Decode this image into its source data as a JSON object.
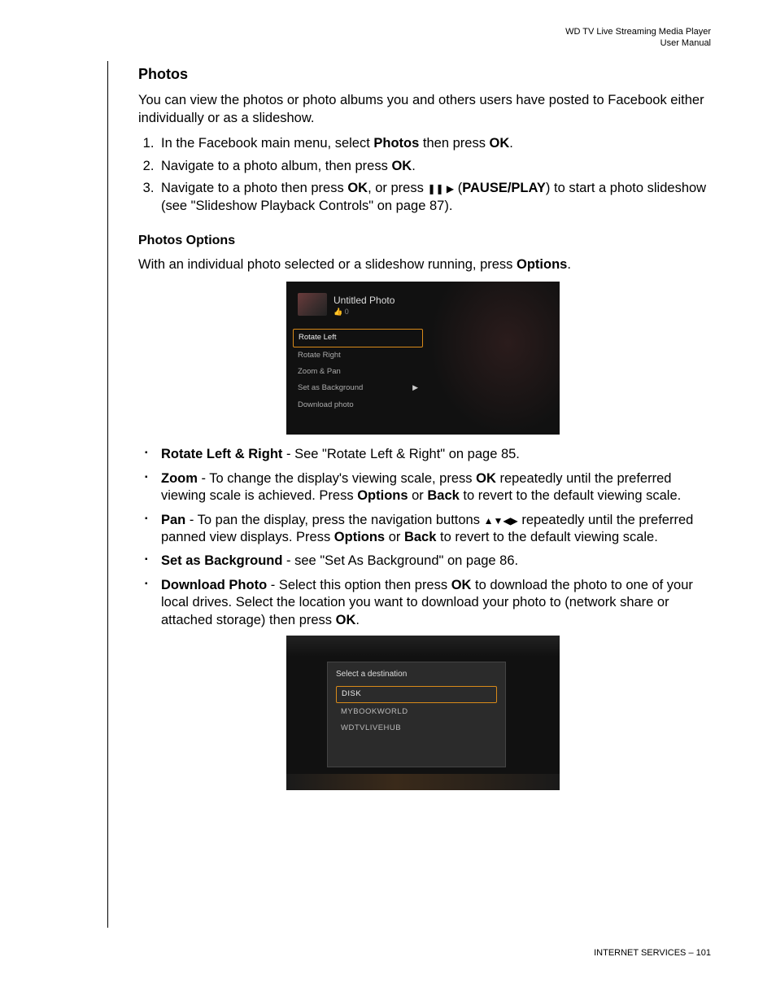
{
  "header": {
    "product": "WD TV Live Streaming Media Player",
    "subtitle": "User Manual"
  },
  "section": {
    "title": "Photos",
    "intro": "You can view the photos or photo albums you and others users have posted to Facebook either individually or as a slideshow.",
    "steps": {
      "s1_a": "In the Facebook main menu, select ",
      "s1_b": "Photos",
      "s1_c": " then press ",
      "s1_d": "OK",
      "s1_e": ".",
      "s2_a": "Navigate to a photo album, then press ",
      "s2_b": "OK",
      "s2_c": ".",
      "s3_a": "Navigate to a photo then press ",
      "s3_b": "OK",
      "s3_c": ", or press ",
      "s3_d": "PAUSE/PLAY",
      "s3_e": ") to start a photo slideshow (see \"Slideshow Playback Controls\" on page 87)."
    },
    "options_heading": "Photos Options",
    "options_intro_a": "With an individual photo selected or a slideshow running, press ",
    "options_intro_b": "Options",
    "options_intro_c": "."
  },
  "screenshot1": {
    "photo_title": "Untitled Photo",
    "photo_meta": "👍 0",
    "items": {
      "rotate_left": "Rotate Left",
      "rotate_right": "Rotate Right",
      "zoom_pan": "Zoom & Pan",
      "set_bg": "Set as Background",
      "download": "Download photo"
    }
  },
  "bullets": {
    "b1_a": "Rotate Left & Right",
    "b1_b": " - See \"Rotate Left & Right\" on page 85.",
    "b2_a": "Zoom",
    "b2_b": " - To change the display's viewing scale, press ",
    "b2_c": "OK",
    "b2_d": " repeatedly until the preferred viewing scale is achieved. Press ",
    "b2_e": "Options",
    "b2_f": " or ",
    "b2_g": "Back",
    "b2_h": " to revert to the default viewing scale.",
    "b3_a": "Pan",
    "b3_b": " - To pan the display, press the navigation buttons ",
    "b3_c": " repeatedly until the preferred panned view displays. Press ",
    "b3_d": "Options",
    "b3_e": " or ",
    "b3_f": "Back",
    "b3_g": " to revert to the default viewing scale.",
    "b4_a": "Set as Background",
    "b4_b": " - see \"Set As Background\" on page 86.",
    "b5_a": "Download Photo",
    "b5_b": " - Select this option then press ",
    "b5_c": "OK",
    "b5_d": " to download the photo to one of your local drives. Select the location you want to download your photo to (network share or attached storage) then press ",
    "b5_e": "OK",
    "b5_f": "."
  },
  "screenshot2": {
    "panel_title": "Select a destination",
    "items": {
      "disk": "DISK",
      "mybook": "MYBOOKWORLD",
      "hub": "WDTVLIVEHUB"
    }
  },
  "footer": {
    "section_name": "INTERNET SERVICES",
    "sep": " – ",
    "page": "101"
  },
  "glyphs": {
    "pauseplay": "❚❚ ▶",
    "open_paren": " (",
    "arrows": "▲▼◀▶"
  }
}
